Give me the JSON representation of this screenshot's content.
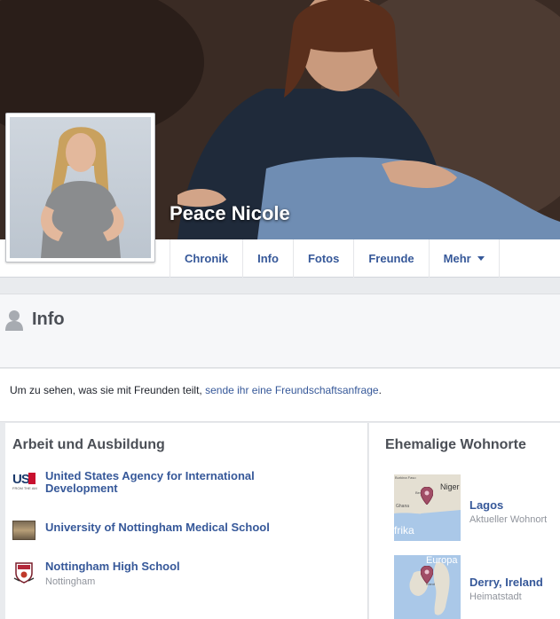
{
  "profile": {
    "name": "Peace Nicole"
  },
  "nav": {
    "tabs": [
      {
        "label": "Chronik"
      },
      {
        "label": "Info"
      },
      {
        "label": "Fotos"
      },
      {
        "label": "Freunde"
      },
      {
        "label": "Mehr"
      }
    ]
  },
  "info": {
    "title": "Info"
  },
  "friend_notice": {
    "text": "Um zu sehen, was sie mit Freunden teilt, ",
    "link": "sende ihr eine Freundschaftsanfrage",
    "suffix": "."
  },
  "work": {
    "title": "Arbeit und Ausbildung",
    "items": [
      {
        "title": "United States Agency for International Development",
        "subtitle": "",
        "logo_text": "US",
        "logo_small": "FROM THE AM"
      },
      {
        "title": "University of Nottingham Medical School",
        "subtitle": ""
      },
      {
        "title": "Nottingham High School",
        "subtitle": "Nottingham"
      }
    ]
  },
  "places": {
    "title": "Ehemalige Wohnorte",
    "items": [
      {
        "title": "Lagos",
        "subtitle": "Aktueller Wohnort",
        "map_labels": [
          "Burkina Faso",
          "Niger",
          "Benin",
          "Ghana",
          "frika"
        ]
      },
      {
        "title": "Derry, Ireland",
        "subtitle": "Heimatstadt",
        "map_labels": [
          "Europa",
          "Irland"
        ]
      }
    ]
  },
  "colors": {
    "link": "#365899",
    "pin": "#a14d66"
  }
}
